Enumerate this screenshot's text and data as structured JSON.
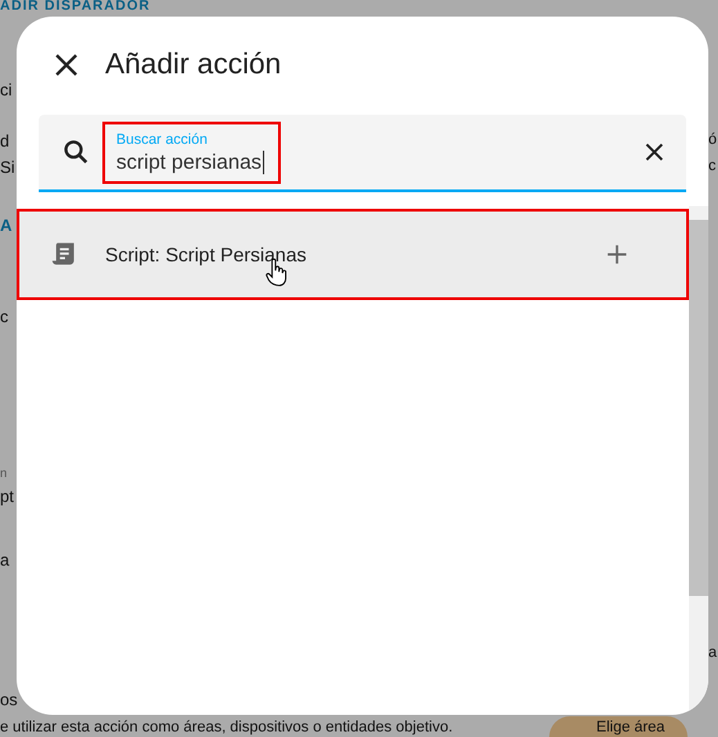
{
  "background": {
    "top_button": "ADIR DISPARADOR",
    "left_fragments": [
      "ci",
      "d",
      "Si",
      "A",
      "c",
      "n",
      "pt",
      "a",
      "os"
    ],
    "right_fragments": [
      "ó",
      "c",
      "a"
    ],
    "hint": "e utilizar esta acción como áreas, dispositivos o entidades objetivo.",
    "area_button": "Elige área"
  },
  "dialog": {
    "title": "Añadir acción",
    "search": {
      "label": "Buscar acción",
      "value": "script persianas",
      "highlighted": true
    },
    "results": [
      {
        "label": "Script: Script Persianas",
        "highlighted": true,
        "hovered": true
      }
    ]
  }
}
